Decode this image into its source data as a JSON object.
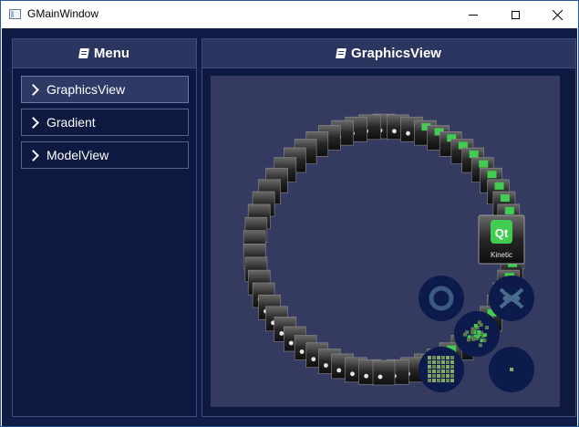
{
  "window": {
    "title": "GMainWindow"
  },
  "controls": {
    "minimize": "minimize",
    "maximize": "maximize",
    "close": "close"
  },
  "menu_panel": {
    "title": "Menu",
    "items": [
      {
        "label": "GraphicsView",
        "active": true
      },
      {
        "label": "Gradient",
        "active": false
      },
      {
        "label": "ModelView",
        "active": false
      }
    ]
  },
  "view_panel": {
    "title": "GraphicsView",
    "featured_card": {
      "logo": "Qt",
      "caption": "Kinetic"
    },
    "card_caption": "Kinetic",
    "shape_buttons": [
      {
        "name": "ellipse-button",
        "icon": "ring-icon"
      },
      {
        "name": "figure8-button",
        "icon": "infinity-icon"
      },
      {
        "name": "random-button",
        "icon": "scatter-icon"
      },
      {
        "name": "tiled-button",
        "icon": "grid-icon"
      },
      {
        "name": "centered-button",
        "icon": "dot-icon"
      }
    ]
  },
  "colors": {
    "background": "#0f1c46",
    "panel_header": "#2a3560",
    "view_bg": "#353b60",
    "qt_green": "#41cd52"
  }
}
